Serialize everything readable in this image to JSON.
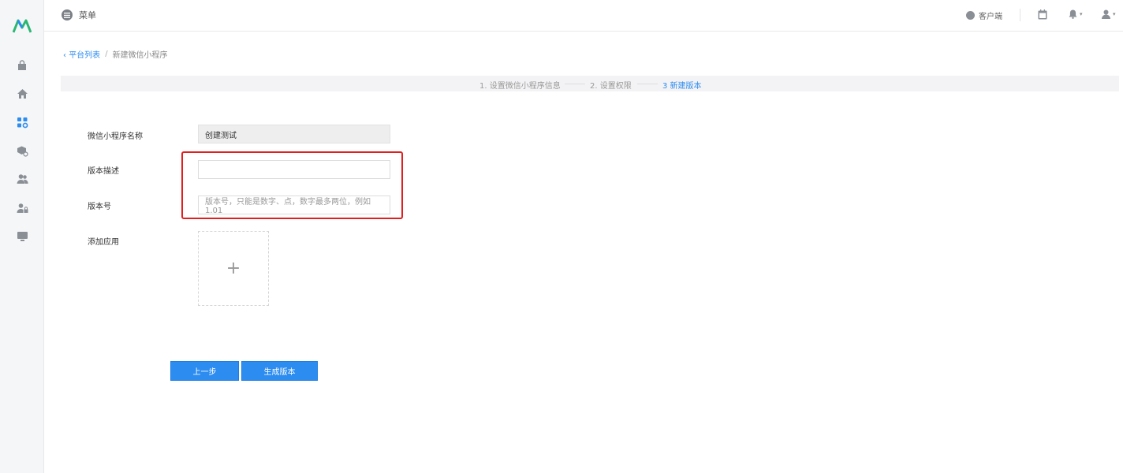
{
  "topbar": {
    "menu_label": "菜单",
    "client_label": "客户端"
  },
  "breadcrumb": {
    "back_label": "平台列表",
    "separator": "/",
    "current": "新建微信小程序"
  },
  "steps": [
    {
      "label": "1. 设置微信小程序信息",
      "active": false
    },
    {
      "label": "2. 设置权限",
      "active": false
    },
    {
      "label": "3 新建版本",
      "active": true
    }
  ],
  "form": {
    "name_label": "微信小程序名称",
    "name_value": "创建测试",
    "desc_label": "版本描述",
    "desc_value": "",
    "version_label": "版本号",
    "version_placeholder": "版本号，只能是数字、点，数字最多两位，例如 1.01",
    "app_label": "添加应用",
    "upload_symbol": "+"
  },
  "buttons": {
    "prev": "上一步",
    "generate": "生成版本"
  },
  "sidebar": {
    "items": [
      "bag-icon",
      "home-icon",
      "apps-settings-icon",
      "box-settings-icon",
      "users-icon",
      "user-lock-icon",
      "monitor-icon"
    ],
    "active_index": 2
  },
  "colors": {
    "accent": "#2d8cf0",
    "highlight": "#e02020",
    "sidebar_bg": "#f5f6f8"
  }
}
